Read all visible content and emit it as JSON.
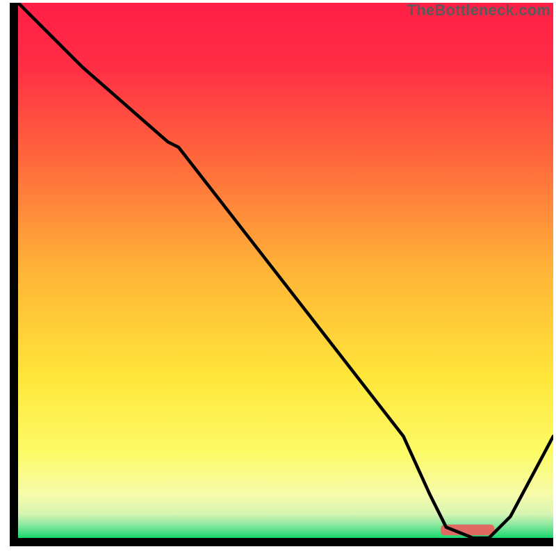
{
  "watermark": "TheBottleneck.com",
  "colors": {
    "gradient_stops": [
      {
        "offset": 0.0,
        "color": "#ff1e46"
      },
      {
        "offset": 0.12,
        "color": "#ff2e45"
      },
      {
        "offset": 0.3,
        "color": "#ff6a3c"
      },
      {
        "offset": 0.5,
        "color": "#ffb437"
      },
      {
        "offset": 0.7,
        "color": "#ffe63a"
      },
      {
        "offset": 0.84,
        "color": "#fdfb67"
      },
      {
        "offset": 0.92,
        "color": "#f6fbaa"
      },
      {
        "offset": 0.955,
        "color": "#d8f5b3"
      },
      {
        "offset": 0.975,
        "color": "#8de8a1"
      },
      {
        "offset": 1.0,
        "color": "#17d86e"
      }
    ],
    "curve": "#000000",
    "marker": "#e06961",
    "axis": "#000000",
    "watermark_text": "#5a5a5a"
  },
  "chart_data": {
    "type": "line",
    "title": "",
    "xlabel": "",
    "ylabel": "",
    "xlim": [
      0,
      100
    ],
    "ylim": [
      0,
      100
    ],
    "series": [
      {
        "name": "bottleneck-curve",
        "x": [
          0,
          12,
          28,
          30,
          44,
          58,
          72,
          77,
          80,
          85,
          88,
          92,
          100
        ],
        "values": [
          100,
          88,
          74,
          73,
          55,
          37,
          19,
          8,
          2,
          0,
          0,
          4,
          19
        ]
      }
    ],
    "optimal_marker": {
      "x_start": 79,
      "x_end": 89,
      "y": 0.5,
      "height": 2.0
    }
  }
}
